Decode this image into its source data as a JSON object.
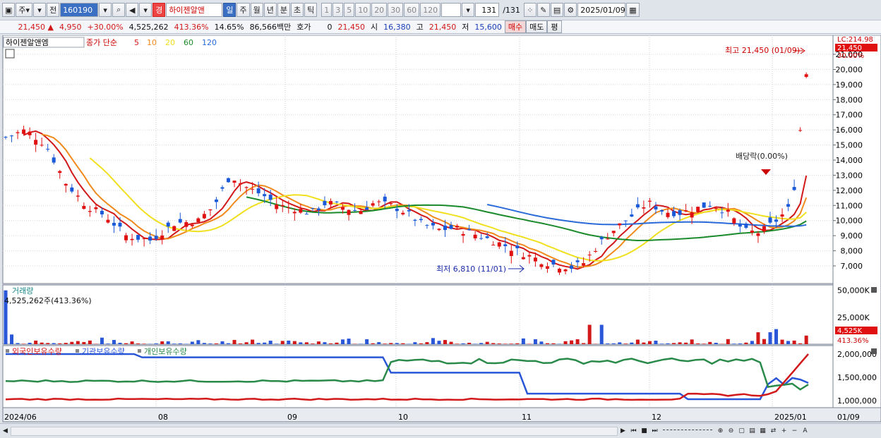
{
  "toolbar": {
    "market": "주",
    "mode": "전",
    "code": "160190",
    "name_badge": "경",
    "stock_name": "하이젠알앤",
    "periods": [
      "일",
      "주",
      "월",
      "년",
      "분",
      "초",
      "틱"
    ],
    "active_period": "일",
    "intervals": [
      "1",
      "3",
      "5",
      "10",
      "20",
      "30",
      "60",
      "120"
    ],
    "count": "131",
    "total": "/131",
    "date": "2025/01/09"
  },
  "quote": {
    "price": "21,450",
    "change": "4,950",
    "rate": "+30.00%",
    "volume": "4,525,262",
    "volume_ratio": "413.36%",
    "turnover": "14.65%",
    "amount": "86,566백만",
    "hoga_label": "호가",
    "hoga_value": "0",
    "hoga_price": "21,450",
    "open_label": "시",
    "open": "16,380",
    "high_label": "고",
    "high": "21,450",
    "low_label": "저",
    "low": "15,600",
    "buy": "매수",
    "sell": "매도",
    "avg": "평"
  },
  "legend": {
    "name": "하이젠알앤엠",
    "series": "종가 단순",
    "mas": [
      {
        "n": "5",
        "color": "#d21818"
      },
      {
        "n": "10",
        "color": "#f08a1c"
      },
      {
        "n": "20",
        "color": "#f0e020"
      },
      {
        "n": "60",
        "color": "#1a8a2a"
      },
      {
        "n": "120",
        "color": "#2a6ad8"
      }
    ]
  },
  "annotations": {
    "high": "최고 21,450 (01/09)",
    "low": "최저 6,810 (11/01)",
    "dividend": "배당락(0.00%)",
    "price_tag": "21,450",
    "lc": "LC:214.98",
    "pct": "30.00%"
  },
  "volume_panel": {
    "title": "거래량",
    "info": "4,525,262주(413.36%)",
    "tag": "4,525K",
    "pct": "413.36%"
  },
  "holdings_panel": {
    "series": [
      {
        "name": "외국인보유수량",
        "color": "#d21818"
      },
      {
        "name": "기관보유수량",
        "color": "#2a56d8"
      },
      {
        "name": "개인보유수량",
        "color": "#2a8a4a"
      }
    ]
  },
  "chart_data": [
    {
      "type": "candlestick",
      "y_ticks": [
        "21,000",
        "20,000",
        "19,000",
        "18,000",
        "17,000",
        "16,000",
        "15,000",
        "14,000",
        "13,000",
        "12,000",
        "11,000",
        "10,000",
        "9,000",
        "8,000",
        "7,000"
      ],
      "ylim": [
        6000,
        22000
      ],
      "x_labels": [
        "2024/06",
        "08",
        "09",
        "10",
        "11",
        "12",
        "2025/01",
        "01/09"
      ]
    },
    {
      "type": "bar",
      "y_ticks": [
        "50,000K",
        "25,000K"
      ]
    },
    {
      "type": "line",
      "y_ticks": [
        "2,000,000",
        "1,500,000",
        "1,000,000"
      ]
    }
  ],
  "scroll": {
    "zoom_icons": [
      "zoom-in",
      "zoom-out",
      "plus",
      "minus",
      "A"
    ]
  }
}
